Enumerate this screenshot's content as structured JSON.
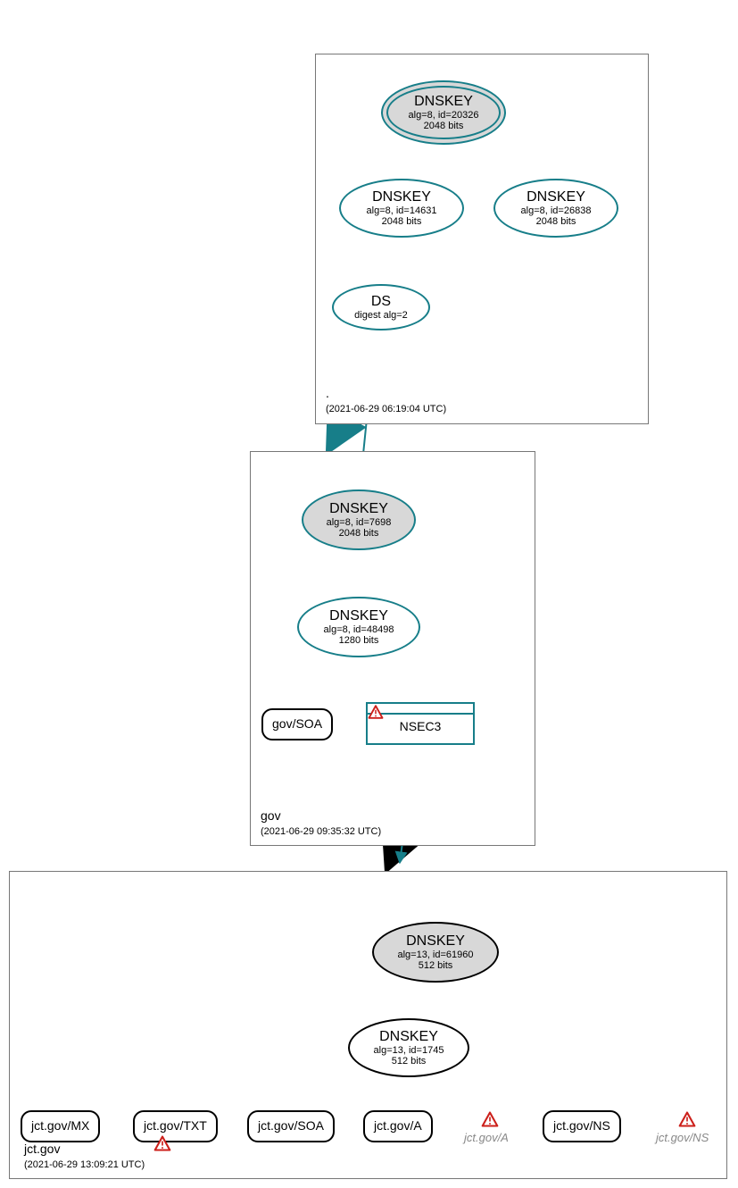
{
  "zones": {
    "root": {
      "name": ".",
      "timestamp": "(2021-06-29 06:19:04 UTC)"
    },
    "gov": {
      "name": "gov",
      "timestamp": "(2021-06-29 09:35:32 UTC)"
    },
    "jct": {
      "name": "jct.gov",
      "timestamp": "(2021-06-29 13:09:21 UTC)"
    }
  },
  "nodes": {
    "rootKsk": {
      "title": "DNSKEY",
      "line2": "alg=8, id=20326",
      "line3": "2048 bits"
    },
    "rootZsk1": {
      "title": "DNSKEY",
      "line2": "alg=8, id=14631",
      "line3": "2048 bits"
    },
    "rootZsk2": {
      "title": "DNSKEY",
      "line2": "alg=8, id=26838",
      "line3": "2048 bits"
    },
    "ds": {
      "title": "DS",
      "line2": "digest alg=2"
    },
    "govKsk": {
      "title": "DNSKEY",
      "line2": "alg=8, id=7698",
      "line3": "2048 bits"
    },
    "govZsk": {
      "title": "DNSKEY",
      "line2": "alg=8, id=48498",
      "line3": "1280 bits"
    },
    "govSoa": {
      "label": "gov/SOA"
    },
    "nsec3": {
      "label": "NSEC3"
    },
    "jctKsk": {
      "title": "DNSKEY",
      "line2": "alg=13, id=61960",
      "line3": "512 bits"
    },
    "jctZsk": {
      "title": "DNSKEY",
      "line2": "alg=13, id=1745",
      "line3": "512 bits"
    },
    "jctMx": {
      "label": "jct.gov/MX"
    },
    "jctTxt": {
      "label": "jct.gov/TXT"
    },
    "jctSoa": {
      "label": "jct.gov/SOA"
    },
    "jctA": {
      "label": "jct.gov/A"
    },
    "jctNs": {
      "label": "jct.gov/NS"
    },
    "ghostA": {
      "label": "jct.gov/A"
    },
    "ghostNs": {
      "label": "jct.gov/NS"
    }
  },
  "colors": {
    "teal": "#177e89",
    "warn_red": "#cc1f1a"
  }
}
